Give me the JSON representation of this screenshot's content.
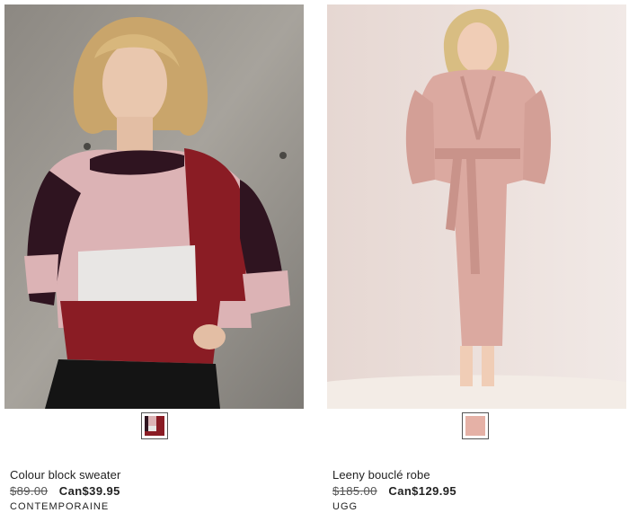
{
  "products": [
    {
      "name": "Colour block sweater",
      "original_price": "$89.00",
      "sale_price": "Can$39.95",
      "brand": "CONTEMPORAINE",
      "swatch_colors": [
        "#8a1c24",
        "#dcb3b5",
        "#e8e6e4",
        "#2f1420"
      ]
    },
    {
      "name": "Leeny bouclé robe",
      "original_price": "$185.00",
      "sale_price": "Can$129.95",
      "brand": "UGG",
      "swatch_colors": [
        "#e5b1a6"
      ]
    }
  ]
}
